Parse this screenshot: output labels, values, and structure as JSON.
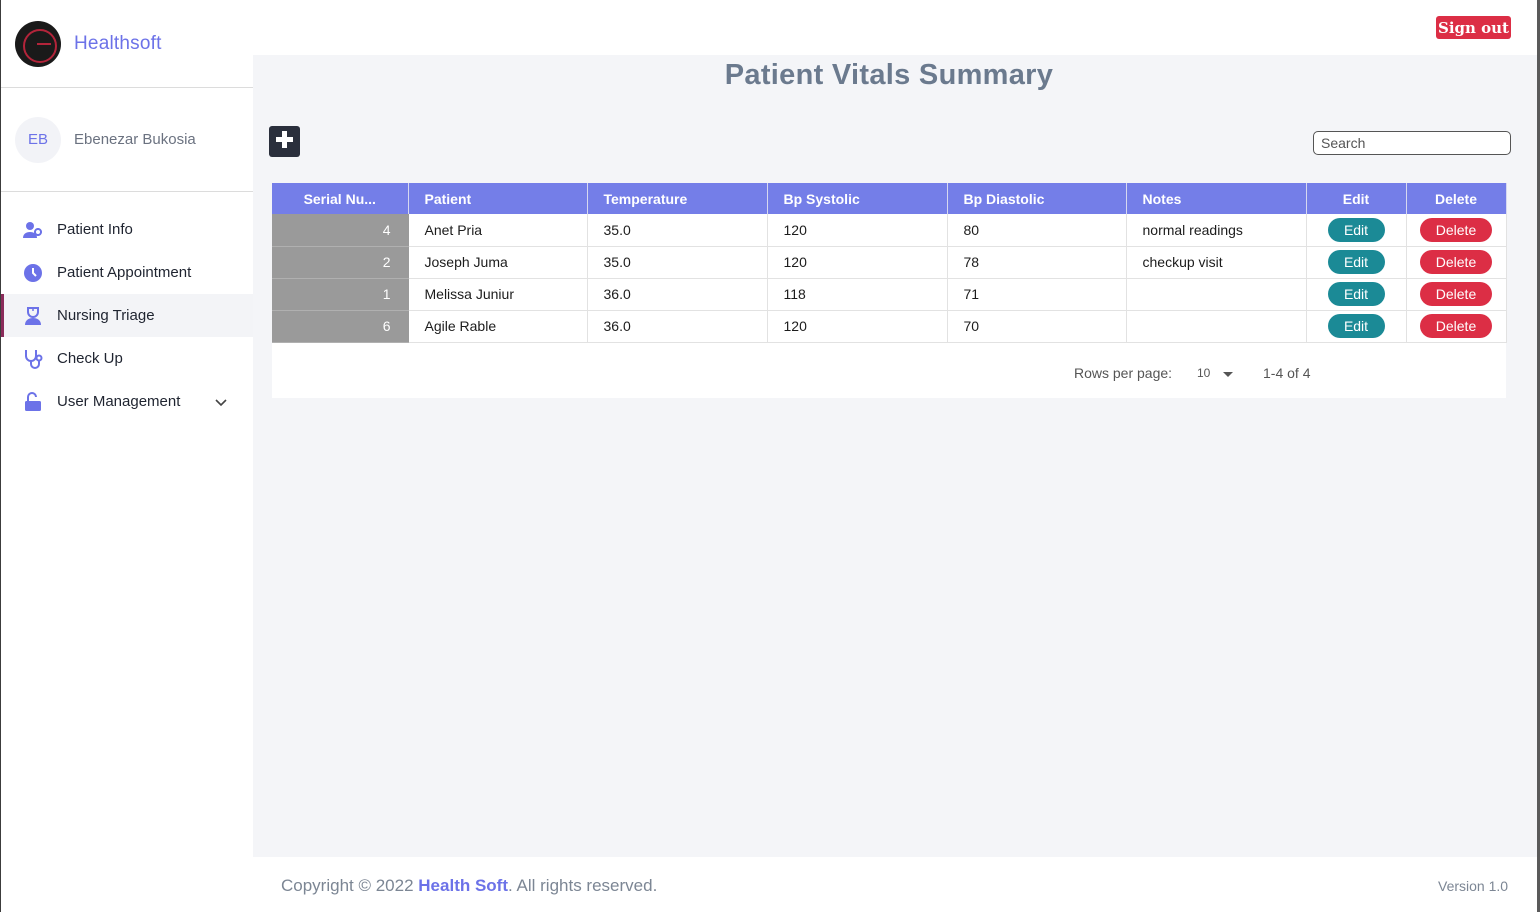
{
  "app": {
    "brand": "Healthsoft",
    "signout_label": "Sign out"
  },
  "user": {
    "initials": "EB",
    "name": "Ebenezar Bukosia"
  },
  "nav": [
    {
      "label": "Patient Info",
      "icon": "user-group-icon"
    },
    {
      "label": "Patient Appointment",
      "icon": "clock-icon"
    },
    {
      "label": "Nursing Triage",
      "icon": "nurse-icon",
      "active": true
    },
    {
      "label": "Check Up",
      "icon": "stethoscope-icon"
    },
    {
      "label": "User Management",
      "icon": "unlock-icon",
      "expandable": true
    }
  ],
  "page": {
    "title": "Patient Vitals Summary",
    "search_placeholder": "Search"
  },
  "table": {
    "headers": [
      "Serial Nu...",
      "Patient",
      "Temperature",
      "Bp Systolic",
      "Bp Diastolic",
      "Notes",
      "Edit",
      "Delete"
    ],
    "rows": [
      {
        "serial": "4",
        "patient": "Anet Pria",
        "temperature": "35.0",
        "bp_systolic": "120",
        "bp_diastolic": "80",
        "notes": "normal readings"
      },
      {
        "serial": "2",
        "patient": "Joseph Juma",
        "temperature": "35.0",
        "bp_systolic": "120",
        "bp_diastolic": "78",
        "notes": "checkup visit"
      },
      {
        "serial": "1",
        "patient": "Melissa Juniur",
        "temperature": "36.0",
        "bp_systolic": "118",
        "bp_diastolic": "71",
        "notes": ""
      },
      {
        "serial": "6",
        "patient": "Agile Rable",
        "temperature": "36.0",
        "bp_systolic": "120",
        "bp_diastolic": "70",
        "notes": ""
      }
    ],
    "edit_label": "Edit",
    "delete_label": "Delete"
  },
  "pagination": {
    "rows_per_page_label": "Rows per page:",
    "rows_per_page": "10",
    "range": "1-4 of 4"
  },
  "footer": {
    "prefix": "Copyright © 2022 ",
    "brand": "Health Soft",
    "suffix": ". All rights reserved.",
    "version": "Version 1.0"
  },
  "colors": {
    "accent": "#747ee8",
    "danger": "#dc2e45",
    "teal": "#1b8a96"
  }
}
